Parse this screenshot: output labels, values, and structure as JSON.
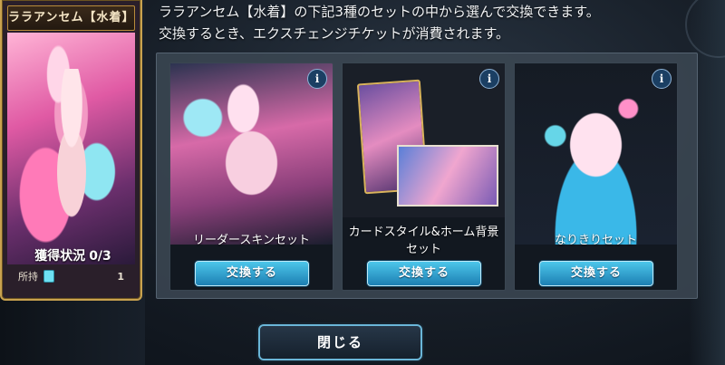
{
  "header": {
    "line1": "ララアンセム【水着】の下記3種のセットの中から選んで交換できます。",
    "line2": "交換するとき、エクスチェンジチケットが消費されます。"
  },
  "character_card": {
    "name": "ララアンセム【水着】",
    "status_label": "獲得状況",
    "status_value": "0/3",
    "owned_label": "所持",
    "owned_count": "1",
    "ticket_icon": "ticket-icon"
  },
  "options": [
    {
      "label": "リーダースキンセット",
      "button": "交換する",
      "info": "i"
    },
    {
      "label": "カードスタイル&ホーム背景セット",
      "button": "交換する",
      "info": "i"
    },
    {
      "label": "なりきりセット",
      "button": "交換する",
      "info": "i"
    }
  ],
  "close_button": "閉じる",
  "colors": {
    "accent_gold": "#c9a24f",
    "button_blue": "#1d7fb3",
    "close_border": "#6ab6d8"
  }
}
